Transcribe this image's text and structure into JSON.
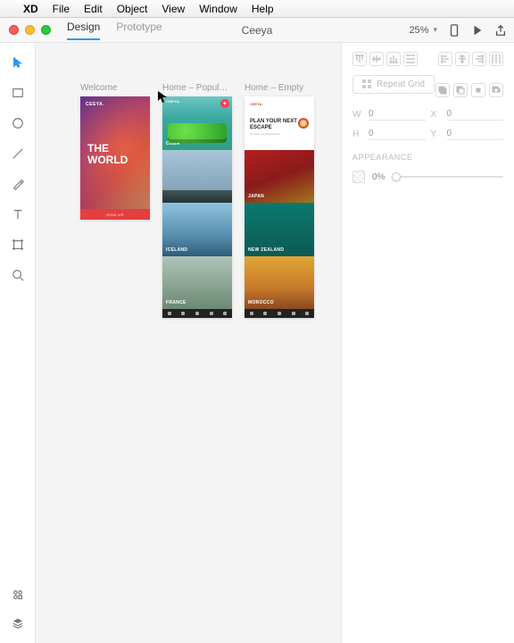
{
  "menubar": {
    "app": "XD",
    "items": [
      "File",
      "Edit",
      "Object",
      "View",
      "Window",
      "Help"
    ]
  },
  "titlebar": {
    "tabs": {
      "design": "Design",
      "prototype": "Prototype"
    },
    "doc": "Ceeya",
    "zoom": "25%"
  },
  "artboards": {
    "welcome": {
      "label": "Welcome",
      "brand": "CEEYA.",
      "title": "THE WORLD",
      "cta": "SIGN UP"
    },
    "home": {
      "label": "Home – Populat...",
      "brand": "CEEYA.",
      "tiles": {
        "cuba": "CUBA",
        "iceland": "ICELAND",
        "france": "FRANCE"
      }
    },
    "empty": {
      "label": "Home – Empty",
      "brand": "CEEYA.",
      "hero_title": "PLAN YOUR NEXT ESCAPE",
      "hero_sub": "To these pro destinations",
      "tiles": {
        "japan": "JAPAN",
        "nz": "NEW ZEALAND",
        "morocco": "MOROCCO"
      }
    }
  },
  "props": {
    "repeat_grid_label": "Repeat Grid",
    "dims": {
      "w_label": "W",
      "w": "0",
      "x_label": "X",
      "x": "0",
      "h_label": "H",
      "h": "0",
      "y_label": "Y",
      "y": "0"
    },
    "appearance_label": "APPEARANCE",
    "opacity": "0%"
  }
}
